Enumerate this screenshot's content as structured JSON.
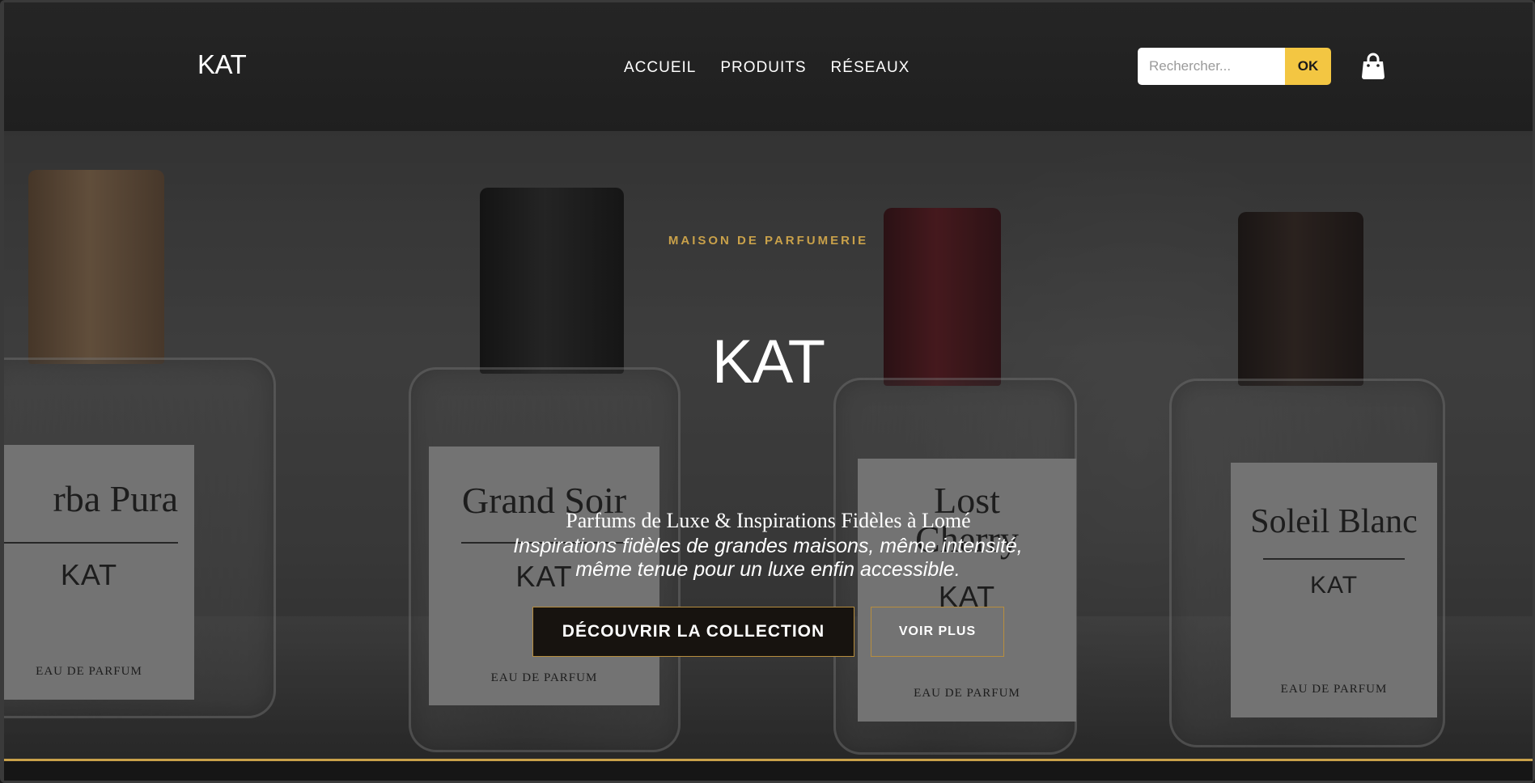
{
  "header": {
    "logo": "KAT",
    "nav": [
      "ACCUEIL",
      "PRODUITS",
      "RÉSEAUX"
    ],
    "search": {
      "placeholder": "Rechercher...",
      "button_label": "OK"
    },
    "cart_icon": "shopping-bag-icon"
  },
  "hero": {
    "eyebrow": "MAISON DE PARFUMERIE",
    "title": "KAT",
    "tagline": "Parfums de Luxe & Inspirations Fidèles à Lomé",
    "subtext": "Inspirations fidèles de grandes maisons, même intensité, même tenue pour un luxe enfin accessible.",
    "primary_button": "DÉCOUVRIR LA COLLECTION",
    "secondary_button": "VOIR PLUS",
    "bottles": [
      {
        "name": "Yerba Pura",
        "visible_name": "rba Pura",
        "brand": "KAT",
        "edp": "EAU DE PARFUM"
      },
      {
        "name": "Grand Soir",
        "visible_name": "Grand Soir",
        "brand": "KAT",
        "edp": "EAU DE PARFUM"
      },
      {
        "name": "Lost Cherry",
        "visible_name": "Lost Cherry",
        "brand": "KAT",
        "edp": "EAU DE PARFUM"
      },
      {
        "name": "Soleil Blanc",
        "visible_name": "Soleil Blanc",
        "brand": "KAT",
        "edp": "EAU DE PARFUM"
      }
    ]
  },
  "colors": {
    "accent_gold": "#c9a14a",
    "search_button": "#f3c642",
    "header_bg": "#222222",
    "primary_button_bg": "#17130f"
  }
}
